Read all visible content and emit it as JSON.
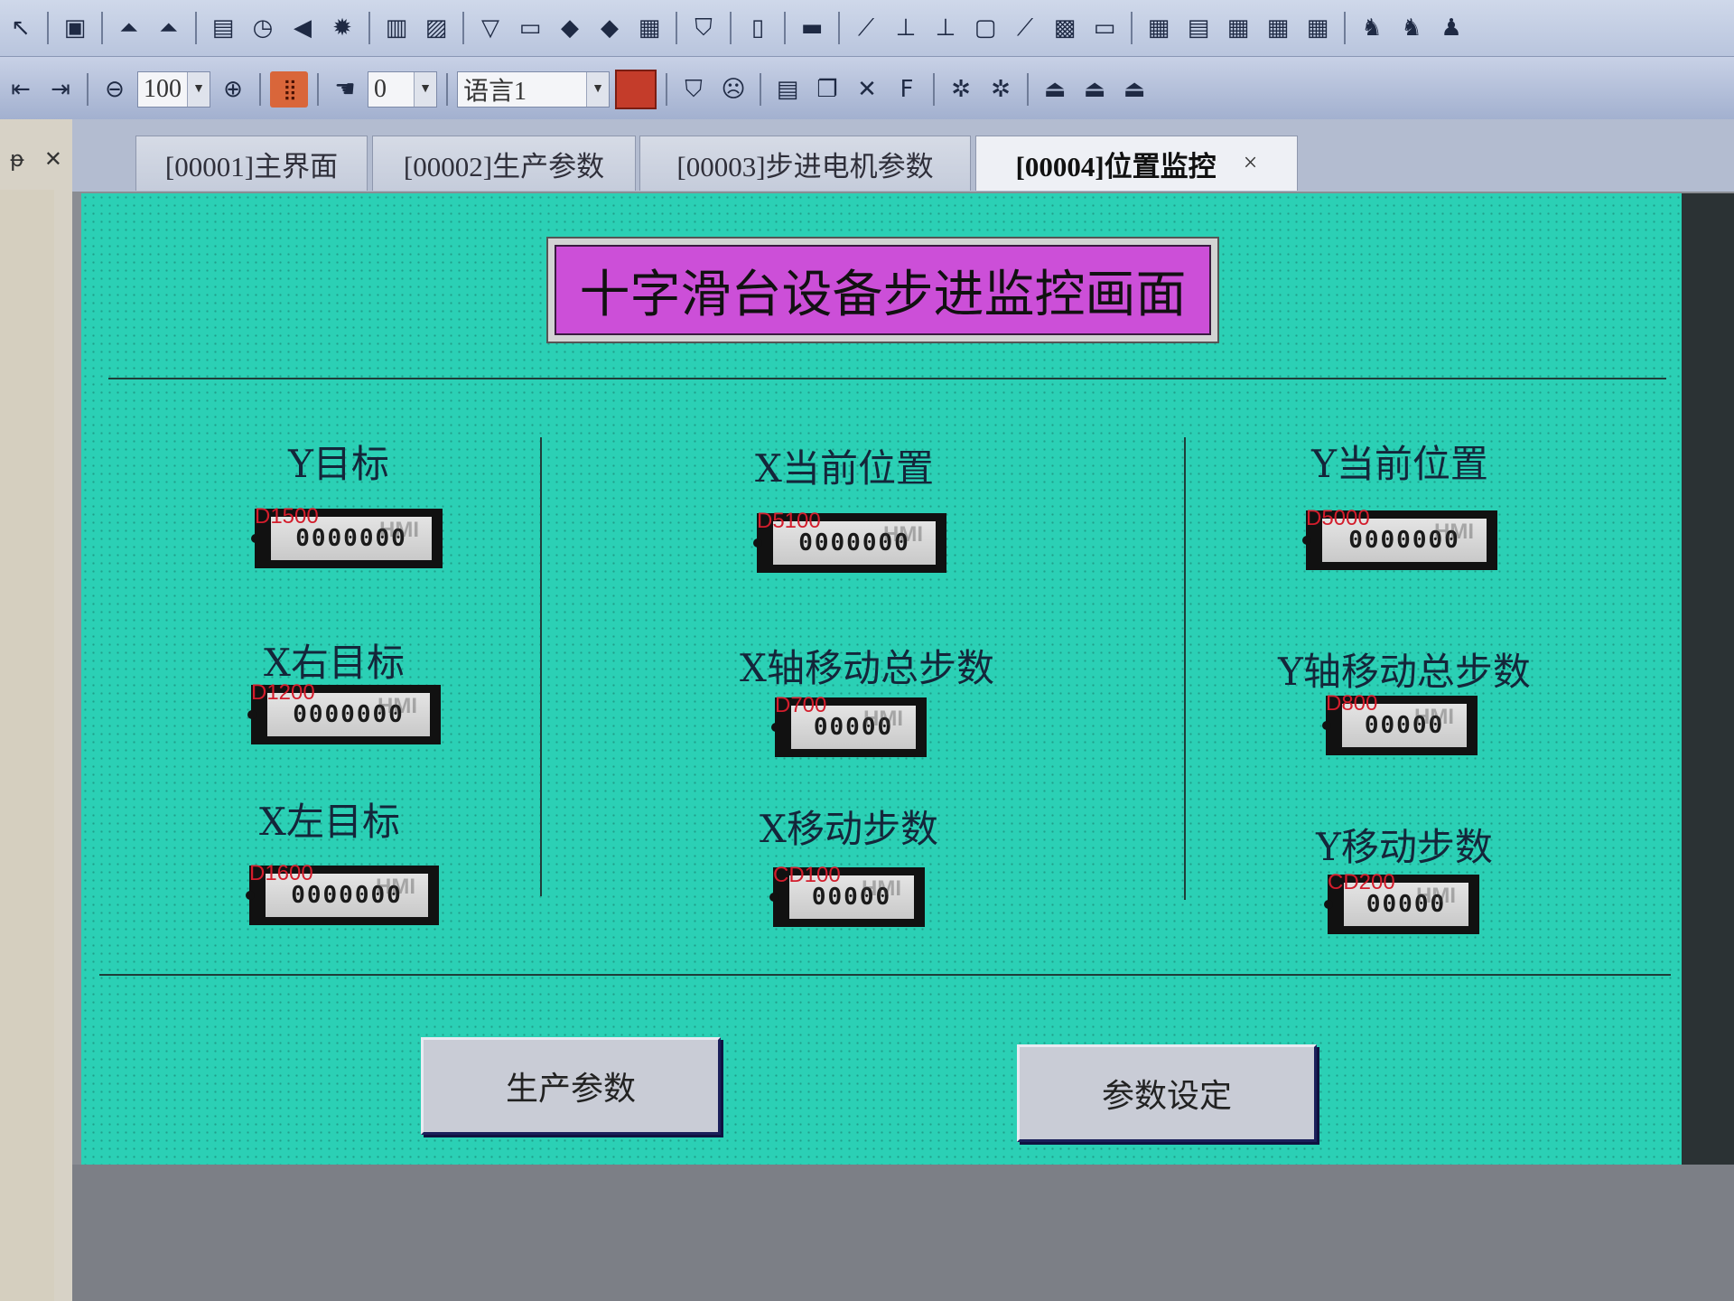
{
  "toolbar1": {
    "icons": [
      "arrow-pointer",
      "chip",
      "triangle-a",
      "triangle-b",
      "device-bar",
      "clock",
      "speaker",
      "sun",
      "bar-graph",
      "image",
      "filter",
      "keyboard",
      "dog-a",
      "dog-b",
      "printer",
      "shield",
      "document",
      "ruler",
      "trend-a",
      "trend-b",
      "trend-c",
      "trend-d",
      "trend-e",
      "calc",
      "mini-window",
      "table-a",
      "table-b",
      "table-c",
      "table-d",
      "table-e",
      "person-a",
      "person-b",
      "flask"
    ]
  },
  "toolbar2": {
    "zoom_value": "100",
    "state_value": "0",
    "language_value": "语言1"
  },
  "tabs": [
    {
      "label": "[00001]主界面"
    },
    {
      "label": "[00002]生产参数"
    },
    {
      "label": "[00003]步进电机参数"
    },
    {
      "label": "[00004]位置监控",
      "active": true
    }
  ],
  "tab_close": "×",
  "dock": {
    "pin": "ᵽ",
    "close": "✕"
  },
  "hmi": {
    "title": "十字滑台设备步进监控画面",
    "left": [
      {
        "label": "Y目标",
        "addr": "D1500",
        "value": "0000000"
      },
      {
        "label": "X右目标",
        "addr": "D1200",
        "value": "0000000"
      },
      {
        "label": "X左目标",
        "addr": "D1600",
        "value": "0000000"
      }
    ],
    "center": [
      {
        "label": "X当前位置",
        "addr": "D5100",
        "value": "0000000"
      },
      {
        "label": "X轴移动总步数",
        "addr": "D700",
        "value": "00000"
      },
      {
        "label": "X移动步数",
        "addr": "CD100",
        "value": "00000"
      }
    ],
    "right": [
      {
        "label": "Y当前位置",
        "addr": "D5000",
        "value": "0000000"
      },
      {
        "label": "Y轴移动总步数",
        "addr": "D800",
        "value": "00000"
      },
      {
        "label": "Y移动步数",
        "addr": "CD200",
        "value": "00000"
      }
    ],
    "faint_tag": "HMI",
    "buttons": {
      "production_params": "生产参数",
      "param_settings": "参数设定"
    }
  },
  "colors": {
    "screen_bg": "#2bd0b5",
    "title_bg": "#cc4fd8",
    "address_text": "#d31d2c"
  }
}
